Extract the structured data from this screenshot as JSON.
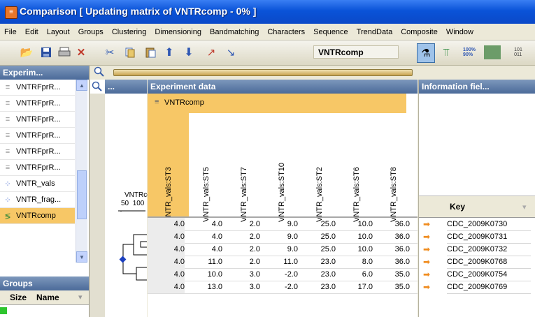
{
  "window": {
    "title": "Comparison  [ Updating matrix of VNTRcomp - 0% ]"
  },
  "menu": [
    "File",
    "Edit",
    "Layout",
    "Groups",
    "Clustering",
    "Dimensioning",
    "Bandmatching",
    "Characters",
    "Sequence",
    "TrendData",
    "Composite",
    "Window"
  ],
  "toolbar": {
    "database_label": "VNTRcomp"
  },
  "left_panel": {
    "experiments_header": "Experim...",
    "experiments": [
      {
        "label": "VNTRFprR...",
        "icon": "fingerprint-icon"
      },
      {
        "label": "VNTRFprR...",
        "icon": "fingerprint-icon"
      },
      {
        "label": "VNTRFprR...",
        "icon": "fingerprint-icon"
      },
      {
        "label": "VNTRFprR...",
        "icon": "fingerprint-icon"
      },
      {
        "label": "VNTRFprR...",
        "icon": "fingerprint-icon"
      },
      {
        "label": "VNTRFprR...",
        "icon": "fingerprint-icon"
      },
      {
        "label": "VNTR_vals",
        "icon": "character-icon"
      },
      {
        "label": "VNTR_frag...",
        "icon": "character-icon"
      },
      {
        "label": "VNTRcomp",
        "icon": "composite-icon",
        "selected": true
      }
    ],
    "groups_header": "Groups",
    "groups_columns": [
      "Size",
      "Name"
    ]
  },
  "dendrogram": {
    "header": "...",
    "label": "VNTRcc",
    "scale": [
      "50",
      "100"
    ]
  },
  "experiment_data": {
    "header": "Experiment data",
    "composite_name": "VNTRcomp",
    "columns": [
      "VNTR_vals:ST3",
      "VNTR_vals:ST5",
      "VNTR_vals:ST7",
      "VNTR_vals:ST10",
      "VNTR_vals:ST2",
      "VNTR_vals:ST6",
      "VNTR_vals:ST8"
    ],
    "rows": [
      [
        "4.0",
        "4.0",
        "2.0",
        "9.0",
        "25.0",
        "10.0",
        "36.0"
      ],
      [
        "4.0",
        "4.0",
        "2.0",
        "9.0",
        "25.0",
        "10.0",
        "36.0"
      ],
      [
        "4.0",
        "4.0",
        "2.0",
        "9.0",
        "25.0",
        "10.0",
        "36.0"
      ],
      [
        "4.0",
        "11.0",
        "2.0",
        "11.0",
        "23.0",
        "8.0",
        "36.0"
      ],
      [
        "4.0",
        "10.0",
        "3.0",
        "-2.0",
        "23.0",
        "6.0",
        "35.0"
      ],
      [
        "4.0",
        "13.0",
        "3.0",
        "-2.0",
        "23.0",
        "17.0",
        "35.0"
      ]
    ]
  },
  "info_panel": {
    "header": "Information fiel...",
    "key_header": "Key",
    "keys": [
      "CDC_2009K0730",
      "CDC_2009K0731",
      "CDC_2009K0732",
      "CDC_2009K0768",
      "CDC_2009K0754",
      "CDC_2009K0769"
    ]
  },
  "colors": {
    "title_bar": "#0a53d8",
    "selection": "#f7c766",
    "panel_header": "#5c7aa6",
    "arrow": "#f08c1f"
  }
}
